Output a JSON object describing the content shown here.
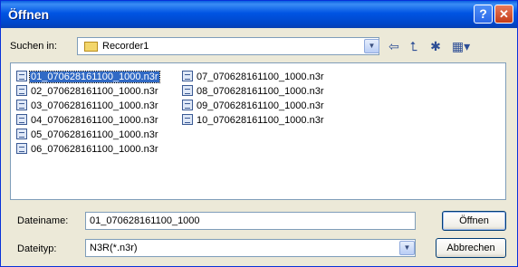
{
  "window": {
    "title": "Öffnen",
    "help_label": "?",
    "close_label": "✕"
  },
  "lookin": {
    "label": "Suchen in:",
    "value": "Recorder1"
  },
  "toolbar": {
    "back_glyph": "⇦",
    "up_glyph": "⮤",
    "newfolder_glyph": "✱",
    "views_glyph": "▦"
  },
  "files": [
    "01_070628161100_1000.n3r",
    "02_070628161100_1000.n3r",
    "03_070628161100_1000.n3r",
    "04_070628161100_1000.n3r",
    "05_070628161100_1000.n3r",
    "06_070628161100_1000.n3r",
    "07_070628161100_1000.n3r",
    "08_070628161100_1000.n3r",
    "09_070628161100_1000.n3r",
    "10_070628161100_1000.n3r"
  ],
  "filename": {
    "label": "Dateiname:",
    "value": "01_070628161100_1000"
  },
  "filetype": {
    "label": "Dateityp:",
    "value": "N3R(*.n3r)"
  },
  "buttons": {
    "open": "Öffnen",
    "cancel": "Abbrechen"
  }
}
